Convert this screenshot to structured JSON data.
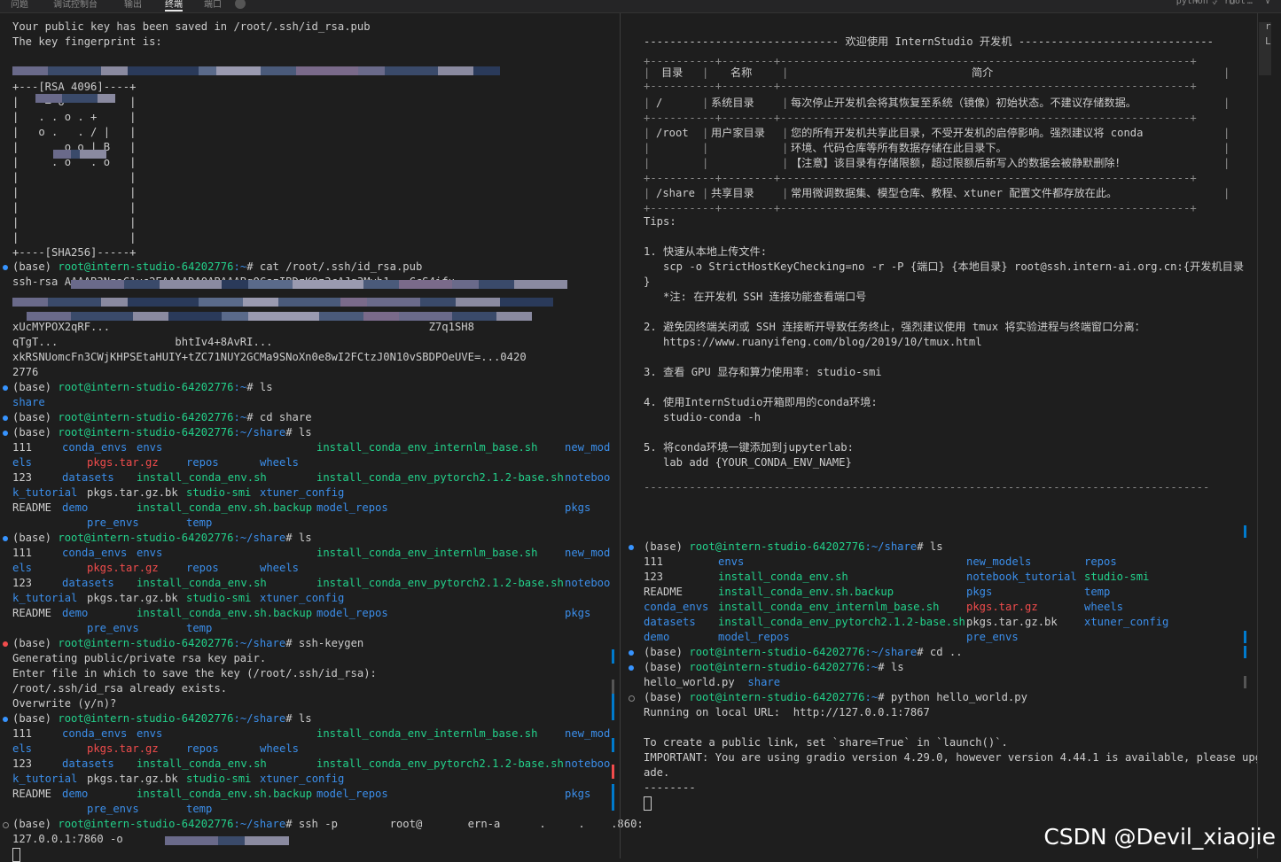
{
  "topbar": {
    "tabs": [
      "问题",
      "调试控制台",
      "输出",
      "终端",
      "端口"
    ],
    "active_tab": "终端",
    "shell_label": "python - root"
  },
  "left": {
    "pre": [
      {
        "t": "Your public key has been saved in /root/.ssh/id_rsa.pub",
        "c": "d"
      },
      {
        "t": "The key fingerprint is:",
        "c": "d"
      },
      {
        "t": "",
        "c": "d"
      },
      {
        "t": "                       is:",
        "c": "d"
      },
      {
        "t": "+---[RSA 4096]----+",
        "c": "d"
      },
      {
        "t": "|    = o          |",
        "c": "d"
      },
      {
        "t": "|   . . o . +     |",
        "c": "d"
      },
      {
        "t": "|   o .   . / |   |",
        "c": "d"
      },
      {
        "t": "|       o o | B   |",
        "c": "d"
      },
      {
        "t": "|     . o   . o   |",
        "c": "d"
      },
      {
        "t": "|                 |",
        "c": "d"
      },
      {
        "t": "|                 |",
        "c": "d"
      },
      {
        "t": "|                 |",
        "c": "d"
      },
      {
        "t": "|                 |",
        "c": "d"
      },
      {
        "t": "|                 |",
        "c": "d"
      },
      {
        "t": "+----[SHA256]-----+",
        "c": "d"
      }
    ],
    "blocks": [
      {
        "dot": "blue",
        "prompt": "(base) ",
        "host": "root@intern-studio-64202776",
        "path": ":~",
        "cmd": "# cat /root/.ssh/id_rsa.pub"
      },
      {
        "out": "ssh-rsa AAAAB3NzaC1yc2EAAAADAQABAAABgQCszIBDzK9z3cAJg3Mvh1...CcS4ifu",
        "c": "d"
      },
      {
        "out": "",
        "c": "d"
      },
      {
        "out": "",
        "c": "d"
      },
      {
        "out": "xUcMYPOX2qRF...                                                 Z7q1SH8",
        "c": "d"
      },
      {
        "out": "qTgT...                  bhtIv4+8AvRI...",
        "c": "d"
      },
      {
        "out": "xkRSNUomcFn3CWjKHPSEtaHUIY+tZC71NUY2GCMa9SNoXn0e8wI2FCtzJ0N10vSBDPOeUVE=...0420",
        "c": "d"
      },
      {
        "out": "2776",
        "c": "d"
      },
      {
        "dot": "blue",
        "prompt": "(base) ",
        "host": "root@intern-studio-64202776",
        "path": ":~",
        "cmd": "# ls"
      },
      {
        "out": "share",
        "c": "b"
      },
      {
        "dot": "blue",
        "prompt": "(base) ",
        "host": "root@intern-studio-64202776",
        "path": ":~",
        "cmd": "# cd share"
      },
      {
        "dot": "blue",
        "prompt": "(base) ",
        "host": "root@intern-studio-64202776",
        "path": ":~/share",
        "cmd": "# ls"
      }
    ],
    "ls_rows": [
      [
        {
          "t": "111",
          "c": "d"
        },
        {
          "t": "conda_envs",
          "c": "b"
        },
        {
          "t": "envs",
          "c": "b"
        },
        {
          "t": "",
          "c": "d"
        },
        {
          "t": "install_conda_env_internlm_base.sh",
          "c": "g"
        },
        {
          "t": "new_mod",
          "c": "b"
        }
      ],
      [
        {
          "t": "els",
          "c": "b"
        },
        {
          "t": "",
          "c": "d"
        },
        {
          "t": "pkgs.tar.gz",
          "c": "r"
        },
        {
          "t": "repos",
          "c": "b"
        },
        {
          "t": "wheels",
          "c": "b"
        },
        {
          "t": "",
          "c": "d"
        }
      ],
      [
        {
          "t": "123",
          "c": "d"
        },
        {
          "t": "datasets",
          "c": "b"
        },
        {
          "t": "install_conda_env.sh",
          "c": "g"
        },
        {
          "t": "",
          "c": "d"
        },
        {
          "t": "install_conda_env_pytorch2.1.2-base.sh",
          "c": "g"
        },
        {
          "t": "noteboo",
          "c": "b"
        }
      ],
      [
        {
          "t": "k_tutorial",
          "c": "b"
        },
        {
          "t": "pkgs.tar.gz.bk",
          "c": "d"
        },
        {
          "t": "studio-smi",
          "c": "g"
        },
        {
          "t": "xtuner_config",
          "c": "b"
        },
        {
          "t": "",
          "c": "d"
        },
        {
          "t": "",
          "c": "d"
        }
      ],
      [
        {
          "t": "README",
          "c": "d"
        },
        {
          "t": "demo",
          "c": "b"
        },
        {
          "t": "install_conda_env.sh.backup",
          "c": "g"
        },
        {
          "t": "model_repos",
          "c": "b"
        },
        {
          "t": "",
          "c": "d"
        },
        {
          "t": "pkgs",
          "c": "b"
        }
      ],
      [
        {
          "t": "",
          "c": "d"
        },
        {
          "t": "pre_envs",
          "c": "b"
        },
        {
          "t": "temp",
          "c": "b"
        },
        {
          "t": "",
          "c": "d"
        },
        {
          "t": "",
          "c": "d"
        },
        {
          "t": "",
          "c": "d"
        }
      ]
    ],
    "keygen": {
      "prompt_cmd": "# ssh-keygen",
      "lines": [
        "Generating public/private rsa key pair.",
        "Enter file in which to save the key (/root/.ssh/id_rsa):",
        "/root/.ssh/id_rsa already exists.",
        "Overwrite (y/n)?"
      ]
    },
    "last_cmd": "# ssh -p        root@       ern-a      .     .    .860:",
    "last_cont": "127.0.0.1:7860 -o "
  },
  "right": {
    "banner": "------------------------------ 欢迎使用 InternStudio 开发机 ------------------------------",
    "table_border": "+----------+--------+---------------------------------------------------------------+",
    "table_header": {
      "col1": "目录",
      "col2": "名称",
      "col3": "简介"
    },
    "table_rows": [
      {
        "dir": "/",
        "name": "系统目录",
        "desc": [
          "每次停止开发机会将其恢复至系统（镜像）初始状态。不建议存储数据。"
        ]
      },
      {
        "dir": "/root",
        "name": "用户家目录",
        "desc": [
          "您的所有开发机共享此目录，不受开发机的启停影响。强烈建议将 conda",
          "环境、代码仓库等所有数据存储在此目录下。",
          "【注意】该目录有存储限额，超过限额后新写入的数据会被静默删除！"
        ]
      },
      {
        "dir": "/share",
        "name": "共享目录",
        "desc": [
          "常用微调数据集、模型仓库、教程、xtuner 配置文件都存放在此。"
        ]
      }
    ],
    "tips_title": "Tips:",
    "tips": [
      [
        "1. 快速从本地上传文件:",
        "   scp -o StrictHostKeyChecking=no -r -P {端口} {本地目录} root@ssh.intern-ai.org.cn:{开发机目录",
        "}",
        "   *注: 在开发机 SSH 连接功能查看端口号"
      ],
      [
        "2. 避免因终端关闭或 SSH 连接断开导致任务终止，强烈建议使用 tmux 将实验进程与终端窗口分离：",
        "   https://www.ruanyifeng.com/blog/2019/10/tmux.html"
      ],
      [
        "3. 查看 GPU 显存和算力使用率: studio-smi"
      ],
      [
        "4. 使用InternStudio开箱即用的conda环境:",
        "   studio-conda -h"
      ],
      [
        "5. 将conda环境一键添加到jupyterlab:",
        "   lab add {YOUR_CONDA_ENV_NAME}"
      ]
    ],
    "dash_line": "---------------------------------------------------------------------------------------",
    "ls_cmd": "# ls",
    "ls_cols": [
      [
        {
          "t": "111",
          "c": "d"
        },
        {
          "t": "123",
          "c": "d"
        },
        {
          "t": "README",
          "c": "d"
        },
        {
          "t": "conda_envs",
          "c": "b"
        },
        {
          "t": "datasets",
          "c": "b"
        },
        {
          "t": "demo",
          "c": "b"
        }
      ],
      [
        {
          "t": "envs",
          "c": "b"
        },
        {
          "t": "install_conda_env.sh",
          "c": "g"
        },
        {
          "t": "install_conda_env.sh.backup",
          "c": "g"
        },
        {
          "t": "install_conda_env_internlm_base.sh",
          "c": "g"
        },
        {
          "t": "install_conda_env_pytorch2.1.2-base.sh",
          "c": "g"
        },
        {
          "t": "model_repos",
          "c": "b"
        }
      ],
      [
        {
          "t": "new_models",
          "c": "b"
        },
        {
          "t": "notebook_tutorial",
          "c": "b"
        },
        {
          "t": "pkgs",
          "c": "b"
        },
        {
          "t": "pkgs.tar.gz",
          "c": "r"
        },
        {
          "t": "pkgs.tar.gz.bk",
          "c": "d"
        },
        {
          "t": "pre_envs",
          "c": "b"
        }
      ],
      [
        {
          "t": "repos",
          "c": "b"
        },
        {
          "t": "studio-smi",
          "c": "g"
        },
        {
          "t": "temp",
          "c": "b"
        },
        {
          "t": "wheels",
          "c": "b"
        },
        {
          "t": "xtuner_config",
          "c": "b"
        },
        {
          "t": "",
          "c": "d"
        }
      ]
    ],
    "cd_cmd": "# cd ..",
    "ls2_cmd": "# ls",
    "ls2_out": [
      {
        "t": "hello_world.py",
        "c": "d"
      },
      {
        "t": "share",
        "c": "b"
      }
    ],
    "py_cmd": "# python hello_world.py",
    "py_out": [
      "Running on local URL:  http://127.0.0.1:7867",
      "",
      "To create a public link, set `share=True` in `launch()`.",
      "IMPORTANT: You are using gradio version 4.29.0, however version 4.44.1 is available, please upgr",
      "ade.",
      "--------"
    ]
  },
  "scrollbar_glyphs": [
    "r",
    "L"
  ],
  "watermark": "CSDN @Devil_xiaojie"
}
